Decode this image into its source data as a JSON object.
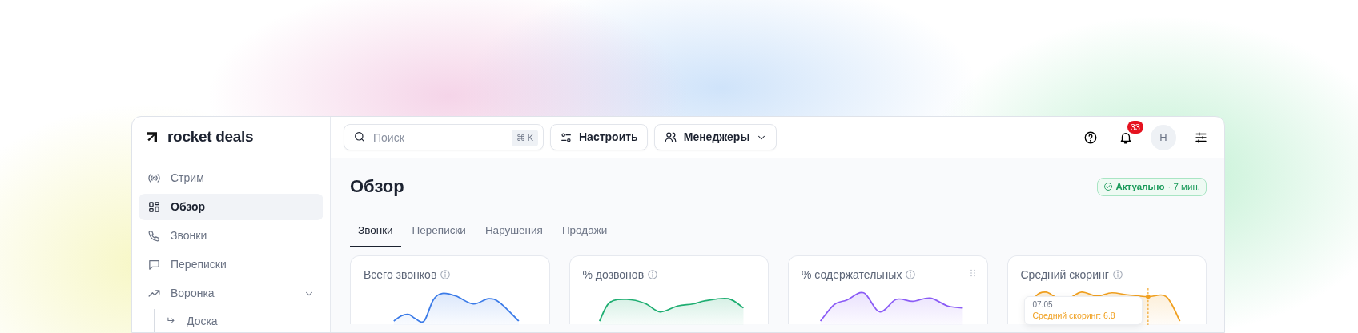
{
  "logo": {
    "text": "rocket deals"
  },
  "header": {
    "search": {
      "placeholder": "Поиск",
      "shortcut": "⌘ K"
    },
    "buttons": [
      {
        "label": "Настроить",
        "kind": "settings"
      },
      {
        "label": "Менеджеры",
        "kind": "dropdown"
      }
    ],
    "notifications": {
      "count": "33"
    },
    "avatar": {
      "initial": "Н"
    }
  },
  "sidebar": {
    "items": [
      {
        "label": "Стрим",
        "kind": "stream",
        "selected": false
      },
      {
        "label": "Обзор",
        "kind": "grid",
        "selected": true
      },
      {
        "label": "Звонки",
        "kind": "phone",
        "selected": false
      },
      {
        "label": "Переписки",
        "kind": "chat",
        "selected": false
      },
      {
        "label": "Воронка",
        "kind": "trend",
        "selected": false,
        "expanded": true,
        "children": [
          {
            "label": "Доска",
            "selected": false
          }
        ]
      }
    ]
  },
  "page": {
    "title": "Обзор",
    "status": {
      "label": "Актуально",
      "age": "· 7 мин."
    }
  },
  "tabs": [
    {
      "label": "Звонки",
      "selected": true
    },
    {
      "label": "Переписки",
      "selected": false
    },
    {
      "label": "Нарушения",
      "selected": false
    },
    {
      "label": "Продажи",
      "selected": false
    }
  ],
  "cards": [
    {
      "title": "Всего звонков",
      "color": "#3b7be8",
      "drag_handle": false
    },
    {
      "title": "% дозвонов",
      "color": "#1fae72",
      "drag_handle": false
    },
    {
      "title": "% содержательных",
      "color": "#8b5cf6",
      "drag_handle": true
    },
    {
      "title": "Средний скоринг",
      "color": "#f0a020",
      "drag_handle": false,
      "tooltip": {
        "date": "07.05",
        "text": "Средний скоринг: 6.8"
      }
    }
  ]
}
